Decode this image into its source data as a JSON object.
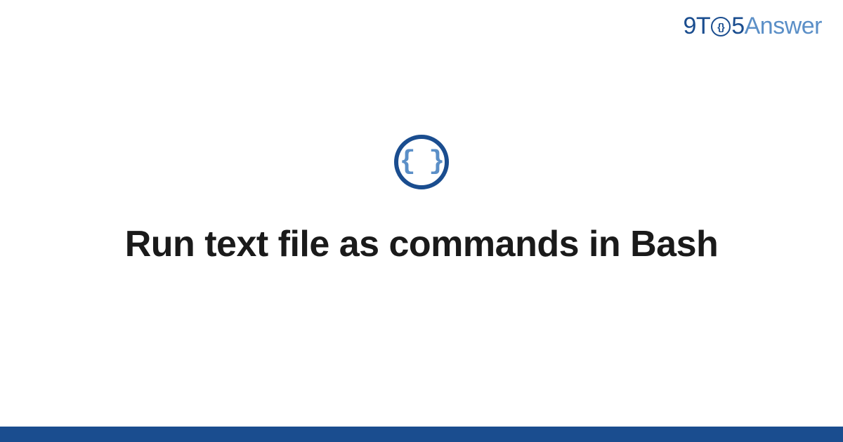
{
  "logo": {
    "part1": "9T",
    "clock_inner": "{}",
    "part2": "5",
    "part3": "Answer"
  },
  "icon": {
    "braces": "{ }"
  },
  "title": "Run text file as commands in Bash"
}
